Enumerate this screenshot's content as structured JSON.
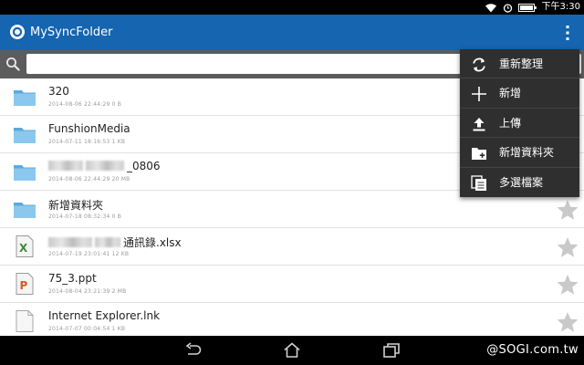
{
  "status_bar": {
    "time": "下午3:30"
  },
  "app_bar": {
    "title": "MySyncFolder"
  },
  "search": {
    "value": "",
    "placeholder": ""
  },
  "files": [
    {
      "name": "320",
      "meta": "2014-08-06 22:44:29 0 B",
      "type": "folder",
      "obscured": false
    },
    {
      "name": "FunshionMedia",
      "meta": "2014-07-11 18:16:53 1 KB",
      "type": "folder",
      "obscured": false
    },
    {
      "name": "_0806",
      "meta": "2014-08-06 22:44:29 20 MB",
      "type": "folder",
      "obscured": true
    },
    {
      "name": "新增資料夾",
      "meta": "2014-07-18 08:32:34 0 B",
      "type": "folder",
      "obscured": false
    },
    {
      "name": "通訊錄.xlsx",
      "meta": "2014-07-19 23:01:41 12 KB",
      "type": "excel",
      "obscured": true
    },
    {
      "name": "75_3.ppt",
      "meta": "2014-08-04 23:21:39 2 MB",
      "type": "ppt",
      "obscured": false
    },
    {
      "name": "Internet Explorer.lnk",
      "meta": "2014-07-07 00:04:54 1 KB",
      "type": "file",
      "obscured": false
    }
  ],
  "menu": {
    "items": [
      {
        "label": "重新整理",
        "icon": "refresh-icon"
      },
      {
        "label": "新增",
        "icon": "plus-icon"
      },
      {
        "label": "上傳",
        "icon": "upload-icon"
      },
      {
        "label": "新增資料夾",
        "icon": "new-folder-icon"
      },
      {
        "label": "多選檔案",
        "icon": "multi-select-icon"
      }
    ]
  },
  "watermark": "@SOGI.com.tw",
  "colors": {
    "app_bar": "#1565b0",
    "search_bar": "#5c5c5c",
    "menu_bg": "#2f2f2f",
    "folder": "#7dbde6"
  }
}
